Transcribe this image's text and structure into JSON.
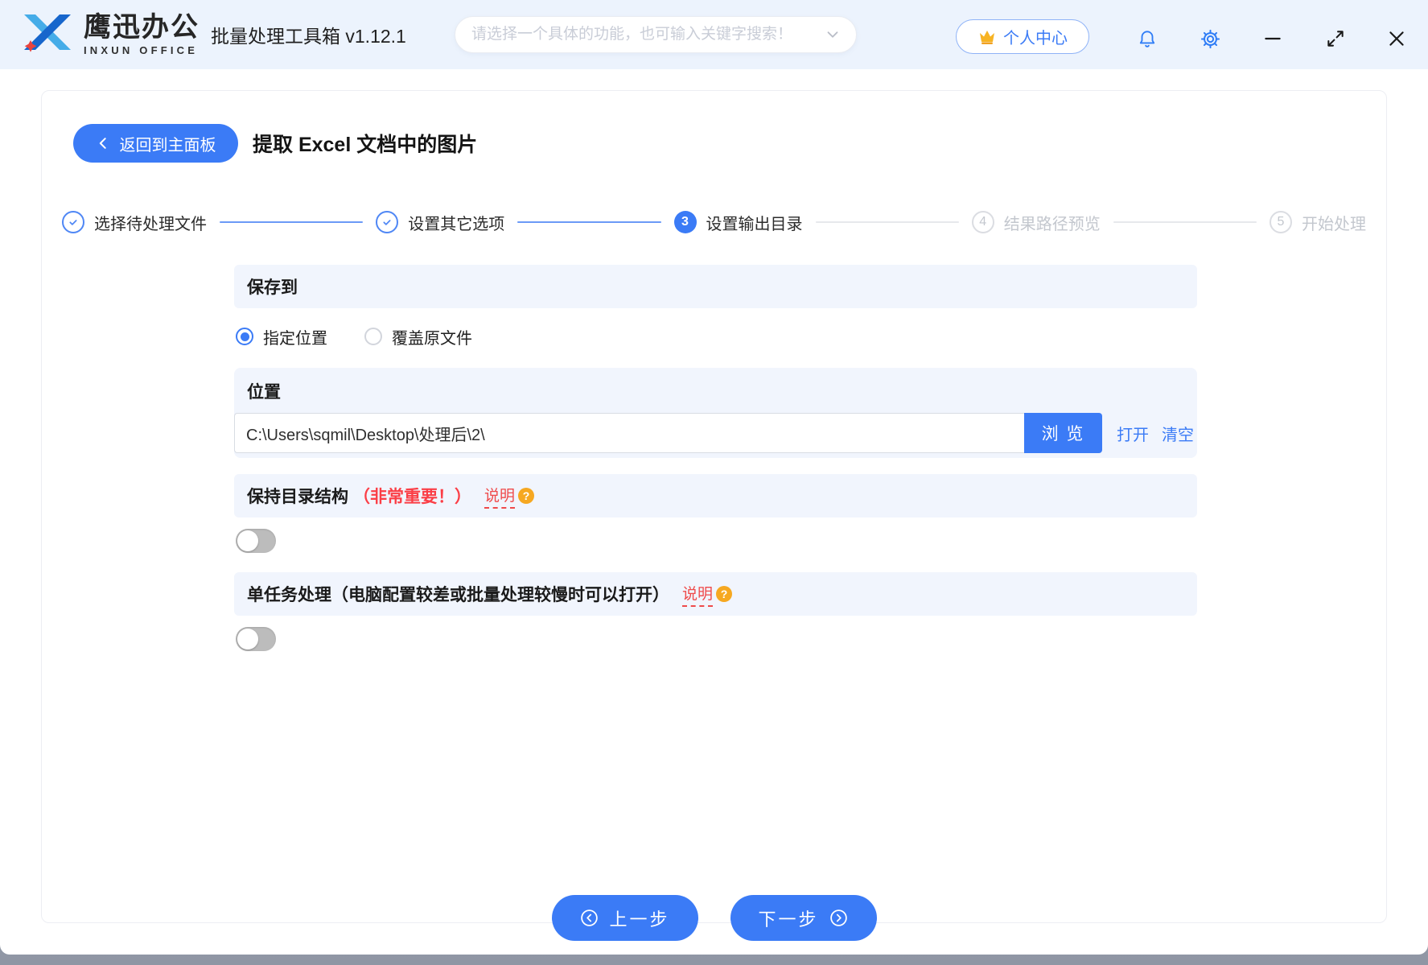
{
  "window": {
    "app_name": "鹰迅办公",
    "app_name_en": "INXUN OFFICE",
    "app_subtitle": "批量处理工具箱 v1.12.1",
    "search_placeholder": "请选择一个具体的功能，也可输入关键字搜索！",
    "personal_center_label": "个人中心"
  },
  "page": {
    "back_label": "返回到主面板",
    "title": "提取 Excel 文档中的图片"
  },
  "steps": [
    {
      "label": "选择待处理文件",
      "state": "done"
    },
    {
      "label": "设置其它选项",
      "state": "done"
    },
    {
      "label": "设置输出目录",
      "state": "active",
      "number": "3"
    },
    {
      "label": "结果路径预览",
      "state": "pending",
      "number": "4"
    },
    {
      "label": "开始处理",
      "state": "pending",
      "number": "5"
    }
  ],
  "form": {
    "save_to": {
      "header": "保存到",
      "options": [
        {
          "label": "指定位置",
          "selected": true
        },
        {
          "label": "覆盖原文件",
          "selected": false
        }
      ]
    },
    "location": {
      "header": "位置",
      "path": "C:\\Users\\sqmil\\Desktop\\处理后\\2\\",
      "browse_label": "浏 览",
      "open_label": "打开",
      "clear_label": "清空"
    },
    "keep_structure": {
      "title": "保持目录结构",
      "important": "（非常重要！）",
      "help_label": "说明",
      "help_badge": "?",
      "enabled": false
    },
    "single_task": {
      "title": "单任务处理（电脑配置较差或批量处理较慢时可以打开）",
      "help_label": "说明",
      "help_badge": "?",
      "enabled": false
    }
  },
  "footer": {
    "prev_label": "上一步",
    "next_label": "下一步"
  },
  "colors": {
    "accent_blue": "#3b7bf6",
    "topbar_bg": "#ecf3fd",
    "section_bg": "#f1f5fd",
    "red_warning": "#fb3e46",
    "orange_badge": "#f6a821",
    "inactive_gray": "#c3c7ce",
    "toggle_off": "#bcbcbc"
  }
}
